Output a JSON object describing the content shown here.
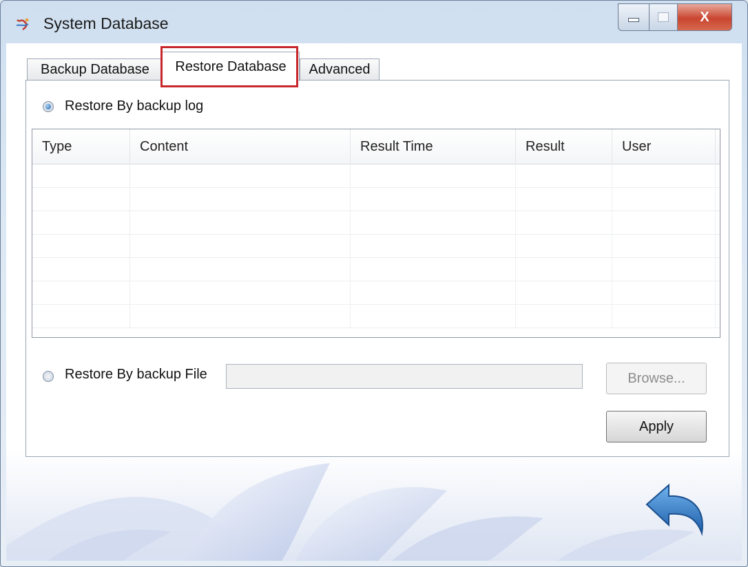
{
  "window": {
    "title": "System Database",
    "close_glyph": "X",
    "icons": [
      "app-logo-icon",
      "minimize-icon",
      "maximize-icon",
      "close-icon",
      "back-arrow-icon"
    ]
  },
  "tabs": [
    {
      "label": "Backup Database",
      "selected": false
    },
    {
      "label": "Restore Database",
      "selected": true
    },
    {
      "label": "Advanced",
      "selected": false
    }
  ],
  "restore": {
    "by_log_label": "Restore By backup log",
    "by_log_selected": true,
    "by_file_label": "Restore By backup File",
    "by_file_selected": false,
    "file_path_value": "",
    "browse_label": "Browse...",
    "apply_label": "Apply"
  },
  "log_table": {
    "columns": [
      "Type",
      "Content",
      "Result Time",
      "Result",
      "User"
    ],
    "rows": []
  },
  "colors": {
    "highlight_border": "#c8262b",
    "close_button": "#c9452f",
    "radio_selected": "#1d5fa8"
  }
}
